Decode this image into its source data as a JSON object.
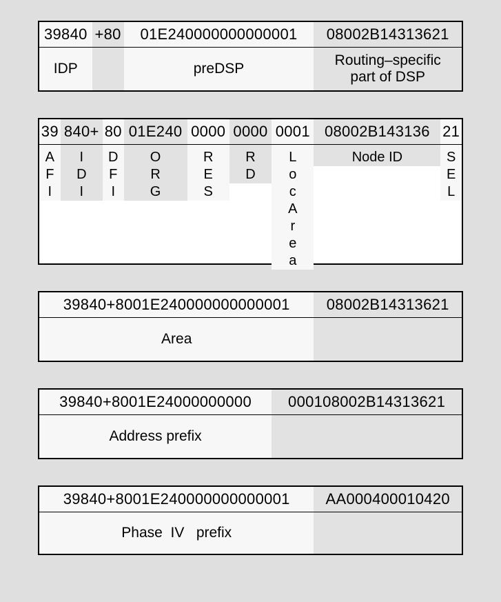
{
  "block1": {
    "hex": {
      "s1": "39840",
      "s2": "+80",
      "s3": "01E240000000000001",
      "s4": "08002B14313621"
    },
    "lab": {
      "idp": "IDP",
      "predsp": "preDSP",
      "routing": "Routing–specific\npart of DSP"
    }
  },
  "block2": {
    "hex": {
      "s1": "39",
      "s2": "840+",
      "s3": "80",
      "s4": "01E240",
      "s5": "0000",
      "s6": "0000",
      "s7": "0001",
      "s8": "08002B143136",
      "s9": "21"
    },
    "lab": {
      "afi": "AFI",
      "idi": "IDI",
      "dfi": "DFI",
      "org": "ORG",
      "res": "RES",
      "rd": "RD",
      "locarea": "LocArea",
      "nodeid": "Node ID",
      "sel": "SEL"
    }
  },
  "block3": {
    "hex": {
      "s1": "39840+8001E240000000000001",
      "s2": "08002B14313621"
    },
    "lab": {
      "area": "Area"
    }
  },
  "block4": {
    "hex": {
      "s1": "39840+8001E24000000000",
      "s2": "000108002B14313621"
    },
    "lab": {
      "addrprefix": "Address prefix"
    }
  },
  "block5": {
    "hex": {
      "s1": "39840+8001E240000000000001",
      "s2": "AA000400010420"
    },
    "lab": {
      "p4prefix": "Phase  IV   prefix"
    }
  }
}
